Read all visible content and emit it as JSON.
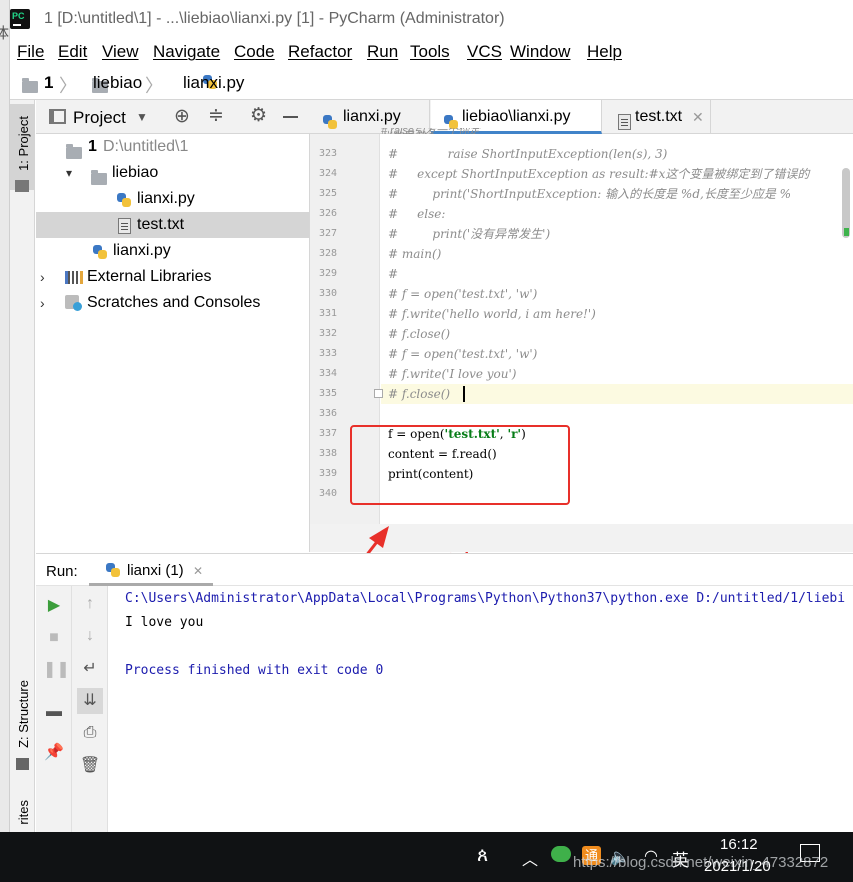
{
  "window": {
    "title": "1 [D:\\untitled\\1] - ...\\liebiao\\lianxi.py [1] - PyCharm (Administrator)"
  },
  "menu": [
    "File",
    "Edit",
    "View",
    "Navigate",
    "Code",
    "Refactor",
    "Run",
    "Tools",
    "VCS",
    "Window",
    "Help"
  ],
  "breadcrumb": {
    "root": "1",
    "folder": "liebiao",
    "file": "lianxi.py"
  },
  "left_strip": {
    "project_tab": "1: Project",
    "structure_tab": "Z: Structure",
    "favorites_tab": "rites"
  },
  "project_panel": {
    "title": "Project",
    "tree": [
      {
        "label": "1",
        "path": "D:\\untitled\\1"
      },
      {
        "label": "liebiao"
      },
      {
        "label": "lianxi.py"
      },
      {
        "label": "test.txt"
      },
      {
        "label": "lianxi.py"
      },
      {
        "label": "External Libraries"
      },
      {
        "label": "Scratches and Consoles"
      }
    ]
  },
  "editor_tabs": [
    {
      "label": "lianxi.py"
    },
    {
      "label": "liebiao\\lianxi.py"
    },
    {
      "label": "test.txt"
    }
  ],
  "code_lines": [
    {
      "num": "323",
      "text": "#             raise ShortInputException(len(s), 3)"
    },
    {
      "num": "324",
      "text": "#     except ShortInputException as result:#x这个变量被绑定到了错误的"
    },
    {
      "num": "325",
      "text": "#         print('ShortInputException: 输入的长度是 %d,长度至少应是 %"
    },
    {
      "num": "326",
      "text": "#     else:"
    },
    {
      "num": "327",
      "text": "#         print('没有异常发生')"
    },
    {
      "num": "328",
      "text": "# main()"
    },
    {
      "num": "329",
      "text": "#"
    },
    {
      "num": "330",
      "text": "# f = open('test.txt', 'w')"
    },
    {
      "num": "331",
      "text": "# f.write('hello world, i am here!')"
    },
    {
      "num": "332",
      "text": "# f.close()"
    },
    {
      "num": "333",
      "text": "# f = open('test.txt', 'w')"
    },
    {
      "num": "334",
      "text": "# f.write('I love you')"
    },
    {
      "num": "335",
      "text": "# f.close()"
    },
    {
      "num": "336",
      "text": ""
    },
    {
      "num": "337",
      "pre": "f = open(",
      "s1": "'test.txt'",
      "mid": ", ",
      "s2": "'r'",
      "post": ")"
    },
    {
      "num": "338",
      "text": "content = f.read()"
    },
    {
      "num": "339",
      "text": "print(content)"
    },
    {
      "num": "340",
      "text": ""
    }
  ],
  "annotation": {
    "text": "读取I love you",
    "color": "#e8302a"
  },
  "run_panel": {
    "label": "Run:",
    "tab": "lianxi (1)",
    "console": [
      "C:\\Users\\Administrator\\AppData\\Local\\Programs\\Python\\Python37\\python.exe D:/untitled/1/liebi",
      "I love you",
      "",
      "Process finished with exit code 0"
    ]
  },
  "taskbar": {
    "time": "16:12",
    "date": "2021/1/20",
    "ime": "英",
    "watermark": "https://blog.csdn.net/weixin_47332872"
  },
  "colors": {
    "accent": "#4083c9",
    "comment": "#8c8c8c",
    "string": "#067d17",
    "console_path": "#1c1cae"
  }
}
